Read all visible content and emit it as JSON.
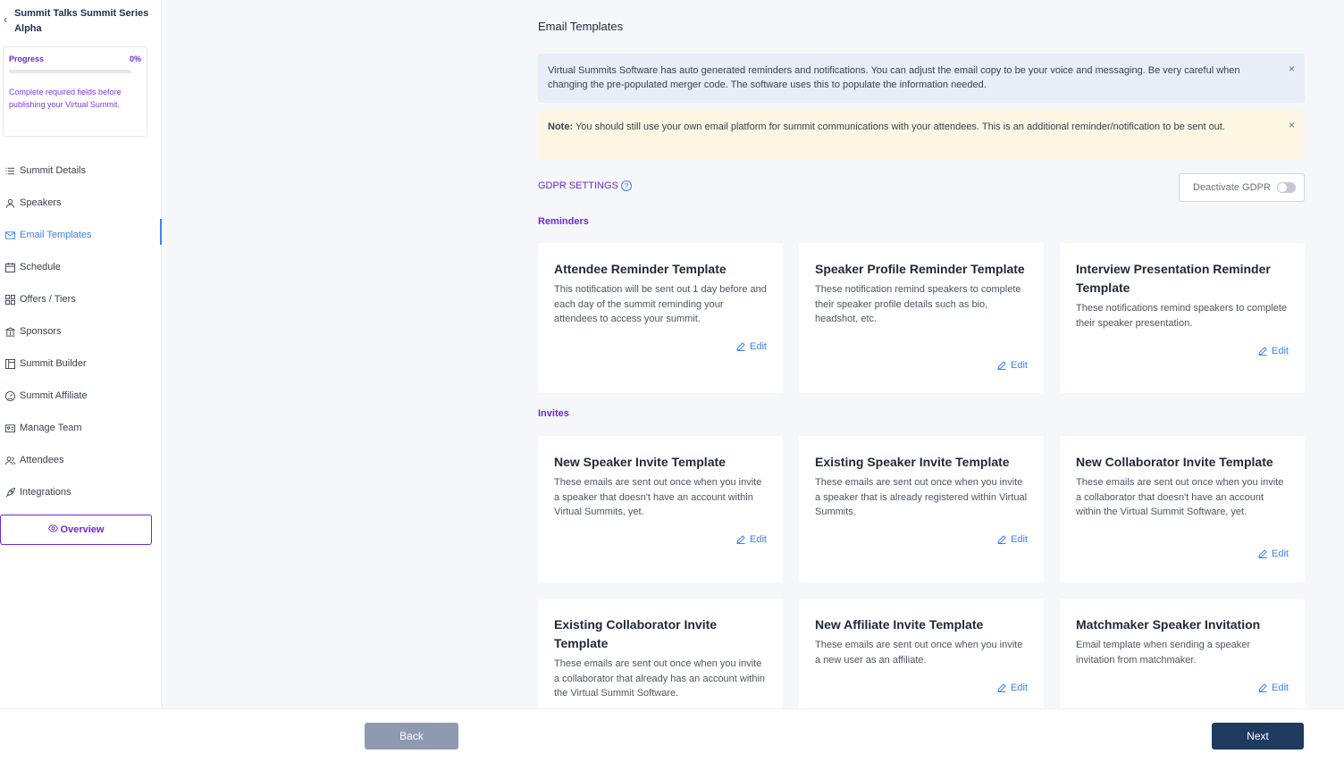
{
  "sidebar": {
    "summit_title": "Summit Talks Summit Series Alpha",
    "progress_label": "Progress",
    "progress_value": "0%",
    "progress_fraction": 0,
    "progress_note": "Complete required fields before publishing your Virtual Summit.",
    "items": [
      {
        "label": "Summit Details",
        "icon": "list-icon"
      },
      {
        "label": "Speakers",
        "icon": "user-icon"
      },
      {
        "label": "Email Templates",
        "icon": "mail-icon",
        "active": true
      },
      {
        "label": "Schedule",
        "icon": "calendar-icon"
      },
      {
        "label": "Offers / Tiers",
        "icon": "grid-icon"
      },
      {
        "label": "Sponsors",
        "icon": "bank-icon"
      },
      {
        "label": "Summit Builder",
        "icon": "layout-icon"
      },
      {
        "label": "Summit Affiliate",
        "icon": "gauge-icon"
      },
      {
        "label": "Manage Team",
        "icon": "id-card-icon"
      },
      {
        "label": "Attendees",
        "icon": "users-icon"
      },
      {
        "label": "Integrations",
        "icon": "rocket-icon"
      }
    ],
    "overview_label": "Overview"
  },
  "main": {
    "title": "Email Templates",
    "info_alert": "Virtual Summits Software has auto generated reminders and notifications. You can adjust the email copy to be your voice and messaging. Be very careful when changing the pre-populated merger code. The software uses this to populate the information needed.",
    "note_alert_bold": "Note:",
    "note_alert_text": " You should still use your own email platform for summit communications with your attendees. This is an additional reminder/notification to be sent out.",
    "close_symbol": "×",
    "gdpr_label": "GDPR SETTINGS",
    "gdpr_toggle_label": "Deactivate GDPR",
    "reminders_label": "Reminders",
    "invites_label": "Invites",
    "edit_label": "Edit",
    "reminders": [
      {
        "title": "Attendee Reminder Template",
        "desc": "This notification will be sent out 1 day before and each day of the summit reminding your attendees to access your summit."
      },
      {
        "title": "Speaker Profile Reminder Template",
        "desc": "These notification remind speakers to complete their speaker profile details such as bio, headshot, etc."
      },
      {
        "title": "Interview Presentation Reminder Template",
        "desc": "These notifications remind speakers to complete their speaker presentation."
      }
    ],
    "invites": [
      {
        "title": "New Speaker Invite Template",
        "desc": "These emails are sent out once when you invite a speaker that doesn't have an account within Virtual Summits, yet."
      },
      {
        "title": "Existing Speaker Invite Template",
        "desc": "These emails are sent out once when you invite a speaker that is already registered within Virtual Summits."
      },
      {
        "title": "New Collaborator Invite Template",
        "desc": "These emails are sent out once when you invite a collaborator that doesn't have an account within the Virtual Summit Software, yet."
      },
      {
        "title": "Existing Collaborator Invite Template",
        "desc": "These emails are sent out once when you invite a collaborator that already has an account within the Virtual Summit Software."
      },
      {
        "title": "New Affiliate Invite Template",
        "desc": "These emails are sent out once when you invite a new user as an affiliate."
      },
      {
        "title": "Matchmaker Speaker Invitation",
        "desc": "Email template when sending a speaker invitation from matchmaker."
      }
    ]
  },
  "footer": {
    "back_label": "Back",
    "next_label": "Next"
  }
}
